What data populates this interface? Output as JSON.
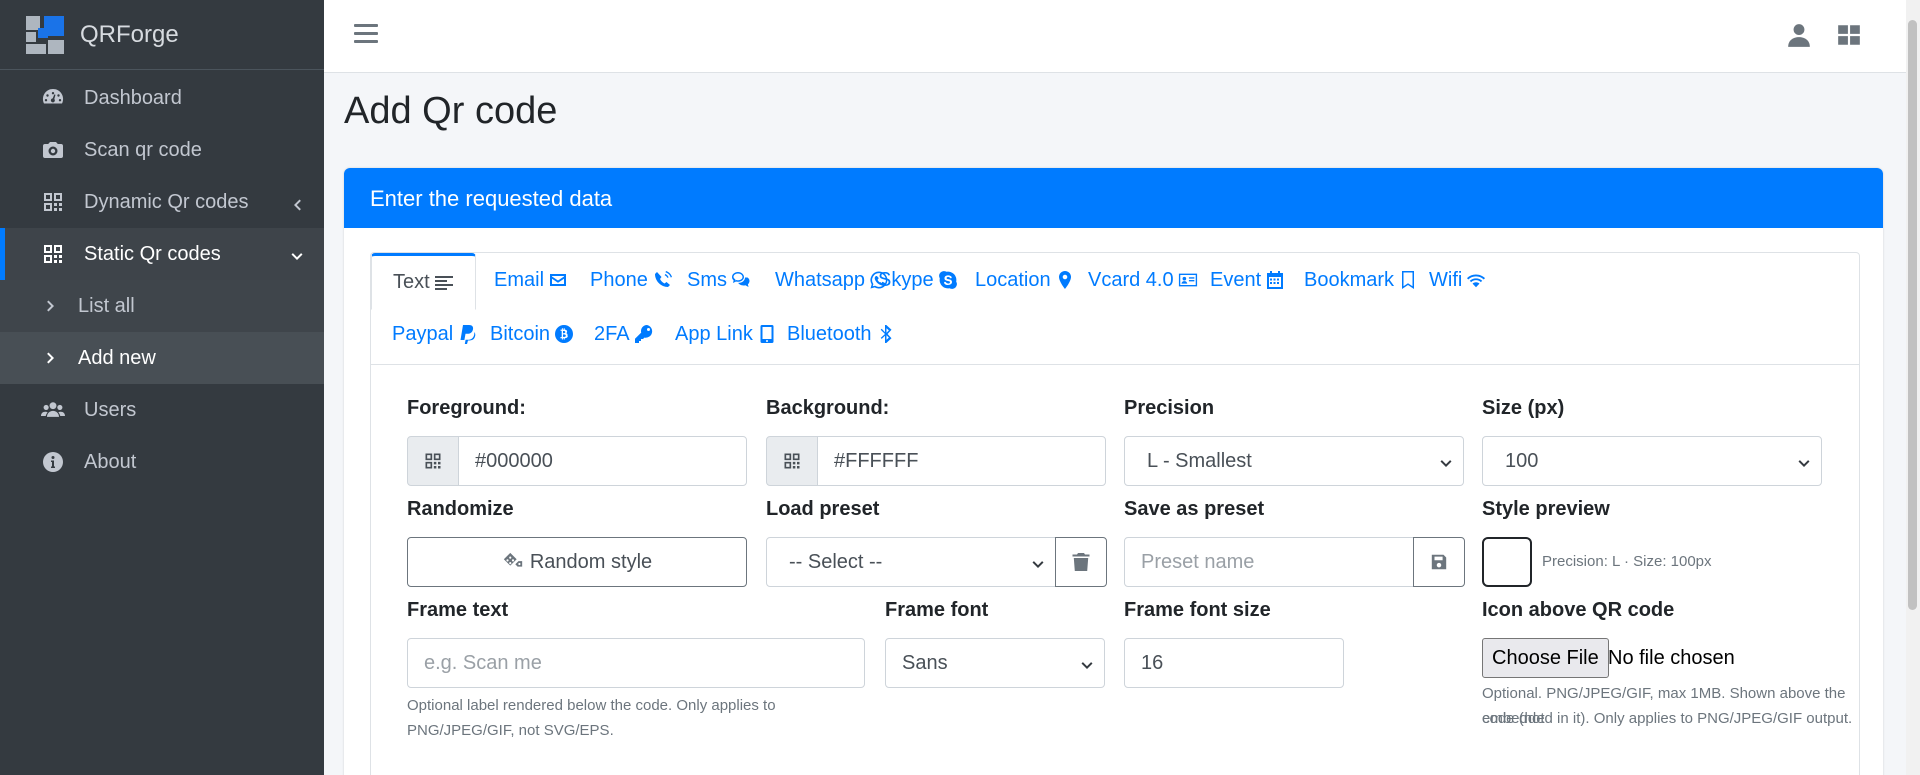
{
  "brand": {
    "name": "QRForge",
    "colors": [
      "#1a73e8",
      "#ffffff"
    ]
  },
  "sidebar": {
    "items": [
      {
        "label": "Dashboard",
        "icon": "tachometer-icon"
      },
      {
        "label": "Scan qr code",
        "icon": "camera-icon"
      },
      {
        "label": "Dynamic Qr codes",
        "icon": "qrcode-icon",
        "arrow": "chevron-left-icon"
      },
      {
        "label": "Static Qr codes",
        "icon": "qrcode-icon",
        "arrow": "chevron-down-icon",
        "active": true
      },
      {
        "label": "List all",
        "icon": "chevron-right-icon",
        "sub": true
      },
      {
        "label": "Add new",
        "icon": "chevron-right-icon",
        "sub": true,
        "current": true
      },
      {
        "label": "Users",
        "icon": "users-icon"
      },
      {
        "label": "About",
        "icon": "info-circle-icon"
      }
    ]
  },
  "topbar": {
    "icons": [
      "hamburger-icon",
      "user-icon",
      "apps-grid-icon"
    ]
  },
  "page": {
    "title": "Add Qr code"
  },
  "card": {
    "header": "Enter the requested data"
  },
  "tabs": [
    {
      "label": "Text",
      "icon": "align-left-icon",
      "active": true
    },
    {
      "label": "Email",
      "icon": "envelope-icon"
    },
    {
      "label": "Phone",
      "icon": "phone-volume-icon"
    },
    {
      "label": "Sms",
      "icon": "comments-icon"
    },
    {
      "label": "Whatsapp",
      "icon": "whatsapp-icon"
    },
    {
      "label": "Skype",
      "icon": "skype-icon"
    },
    {
      "label": "Location",
      "icon": "map-marker-icon"
    },
    {
      "label": "Vcard 4.0",
      "icon": "id-card-icon"
    },
    {
      "label": "Event",
      "icon": "calendar-icon"
    },
    {
      "label": "Bookmark",
      "icon": "bookmark-icon"
    },
    {
      "label": "Wifi",
      "icon": "wifi-icon"
    },
    {
      "label": "Paypal",
      "icon": "paypal-icon"
    },
    {
      "label": "Bitcoin",
      "icon": "bitcoin-icon"
    },
    {
      "label": "2FA",
      "icon": "key-icon"
    },
    {
      "label": "App Link",
      "icon": "mobile-icon"
    },
    {
      "label": "Bluetooth",
      "icon": "bluetooth-icon"
    }
  ],
  "form": {
    "foreground": {
      "label": "Foreground:",
      "value": "#000000"
    },
    "background": {
      "label": "Background:",
      "value": "#FFFFFF"
    },
    "precision": {
      "label": "Precision",
      "value": "L - Smallest"
    },
    "size": {
      "label": "Size (px)",
      "value": "100"
    },
    "randomize": {
      "label": "Randomize",
      "button": "Random style"
    },
    "load_preset": {
      "label": "Load preset",
      "value": "-- Select --"
    },
    "save_preset": {
      "label": "Save as preset",
      "placeholder": "Preset name"
    },
    "style_preview": {
      "label": "Style preview",
      "text": "Precision: L · Size: 100px"
    },
    "frame_text": {
      "label": "Frame text",
      "placeholder": "e.g. Scan me",
      "help_line1": "Optional label rendered below the code. Only applies to",
      "help_line2": "PNG/JPEG/GIF, not SVG/EPS."
    },
    "frame_font": {
      "label": "Frame font",
      "value": "Sans"
    },
    "frame_font_size": {
      "label": "Frame font size",
      "value": "16"
    },
    "icon_above": {
      "label": "Icon above QR code",
      "button": "Choose File",
      "status": "No file chosen",
      "help_line1": "Optional. PNG/JPEG/GIF, max 1MB. Shown above the code (not",
      "help_line2": "embedded in it). Only applies to PNG/JPEG/GIF output."
    }
  }
}
